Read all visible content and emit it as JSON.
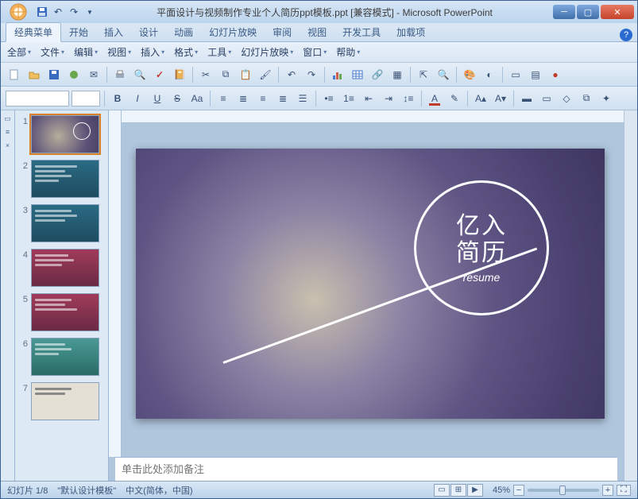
{
  "title": "平面设计与视频制作专业个人简历ppt模板.ppt [兼容模式] - Microsoft PowerPoint",
  "ribbon": {
    "tabs": [
      "经典菜单",
      "开始",
      "插入",
      "设计",
      "动画",
      "幻灯片放映",
      "审阅",
      "视图",
      "开发工具",
      "加载项"
    ],
    "active": 0
  },
  "menu": [
    "全部",
    "文件",
    "编辑",
    "视图",
    "插入",
    "格式",
    "工具",
    "幻灯片放映",
    "窗口",
    "帮助"
  ],
  "slide": {
    "line1": "亿入",
    "line2": "简历",
    "sub": "resume"
  },
  "thumbs": [
    1,
    2,
    3,
    4,
    5,
    6,
    7
  ],
  "notes_placeholder": "单击此处添加备注",
  "status": {
    "slide": "幻灯片 1/8",
    "template": "\"默认设计模板\"",
    "lang": "中文(简体，中国)",
    "zoom": "45%"
  },
  "format": {
    "bold": "B",
    "italic": "I",
    "underline": "U",
    "strike": "S",
    "caps": "Aa"
  }
}
